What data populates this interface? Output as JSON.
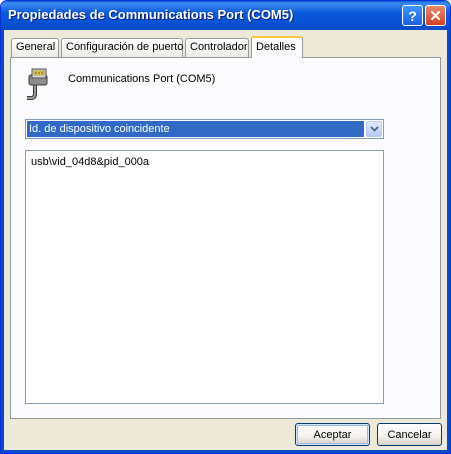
{
  "window": {
    "title": "Propiedades de Communications Port (COM5)",
    "help_label": "?",
    "close_label": "✕"
  },
  "tabs": [
    {
      "label": "General",
      "active": false
    },
    {
      "label": "Configuración de puerto",
      "active": false
    },
    {
      "label": "Controlador",
      "active": false
    },
    {
      "label": "Detalles",
      "active": true
    }
  ],
  "device": {
    "icon": "serial-port-icon",
    "name": "Communications Port (COM5)"
  },
  "property_select": {
    "value": "Id. de dispositivo coincidente"
  },
  "values_list": {
    "items": [
      "usb\\vid_04d8&pid_000a"
    ]
  },
  "buttons": {
    "ok": "Aceptar",
    "cancel": "Cancelar"
  },
  "colors": {
    "titlebar": "#0A5FD8",
    "selection": "#316AC5",
    "active_tab_accent": "#FFC73C",
    "close_button": "#D3401E"
  }
}
